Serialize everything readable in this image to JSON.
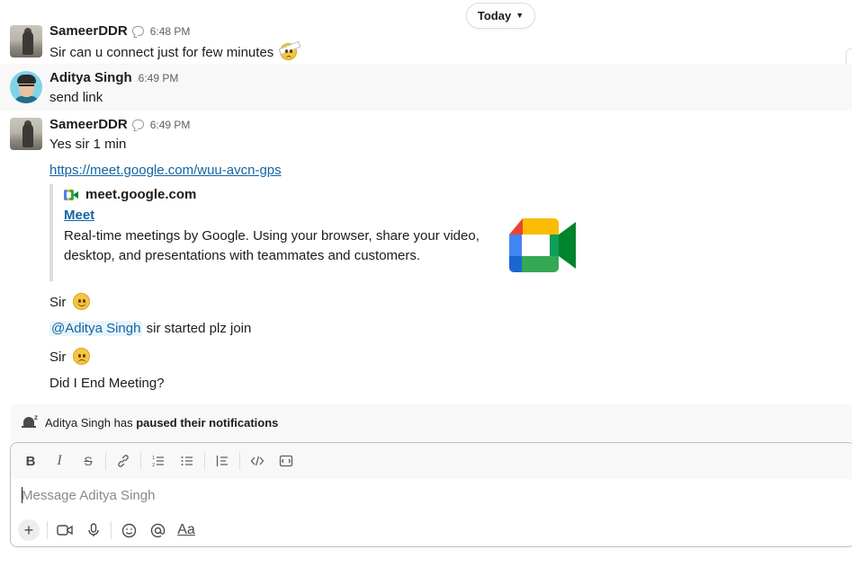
{
  "date_divider": {
    "label": "Today"
  },
  "messages": [
    {
      "author": "SameerDDR",
      "time": "6:48 PM",
      "text": "Sir can u connect just for few minutes"
    },
    {
      "author": "Aditya Singh",
      "time": "6:49 PM",
      "text": "send link"
    },
    {
      "author": "SameerDDR",
      "time": "6:49 PM",
      "text": "Yes sir 1 min"
    }
  ],
  "link": {
    "url": "https://meet.google.com/wuu-avcn-gps"
  },
  "unfurl": {
    "site": "meet.google.com",
    "title": "Meet",
    "description": "Real-time meetings by Google. Using your browser, share your video, desktop, and presentations with teammates and customers."
  },
  "followups": {
    "sir1": "Sir",
    "mention": "@Aditya Singh",
    "mention_rest": "sir started plz join",
    "sir2": "Sir",
    "end": "Did I End Meeting?"
  },
  "notification": {
    "user": "Aditya Singh",
    "has": "has",
    "status": "paused their notifications"
  },
  "composer": {
    "placeholder": "Message Aditya Singh",
    "toolbar": [
      "B",
      "I",
      "S",
      "link",
      "ordered-list",
      "bulleted-list",
      "blockquote",
      "code",
      "code-block"
    ],
    "aa_label": "Aa"
  },
  "colors": {
    "link": "#1264a3",
    "mention_bg": "#e8f5fa",
    "highlight_bg": "#f8f8f8"
  }
}
